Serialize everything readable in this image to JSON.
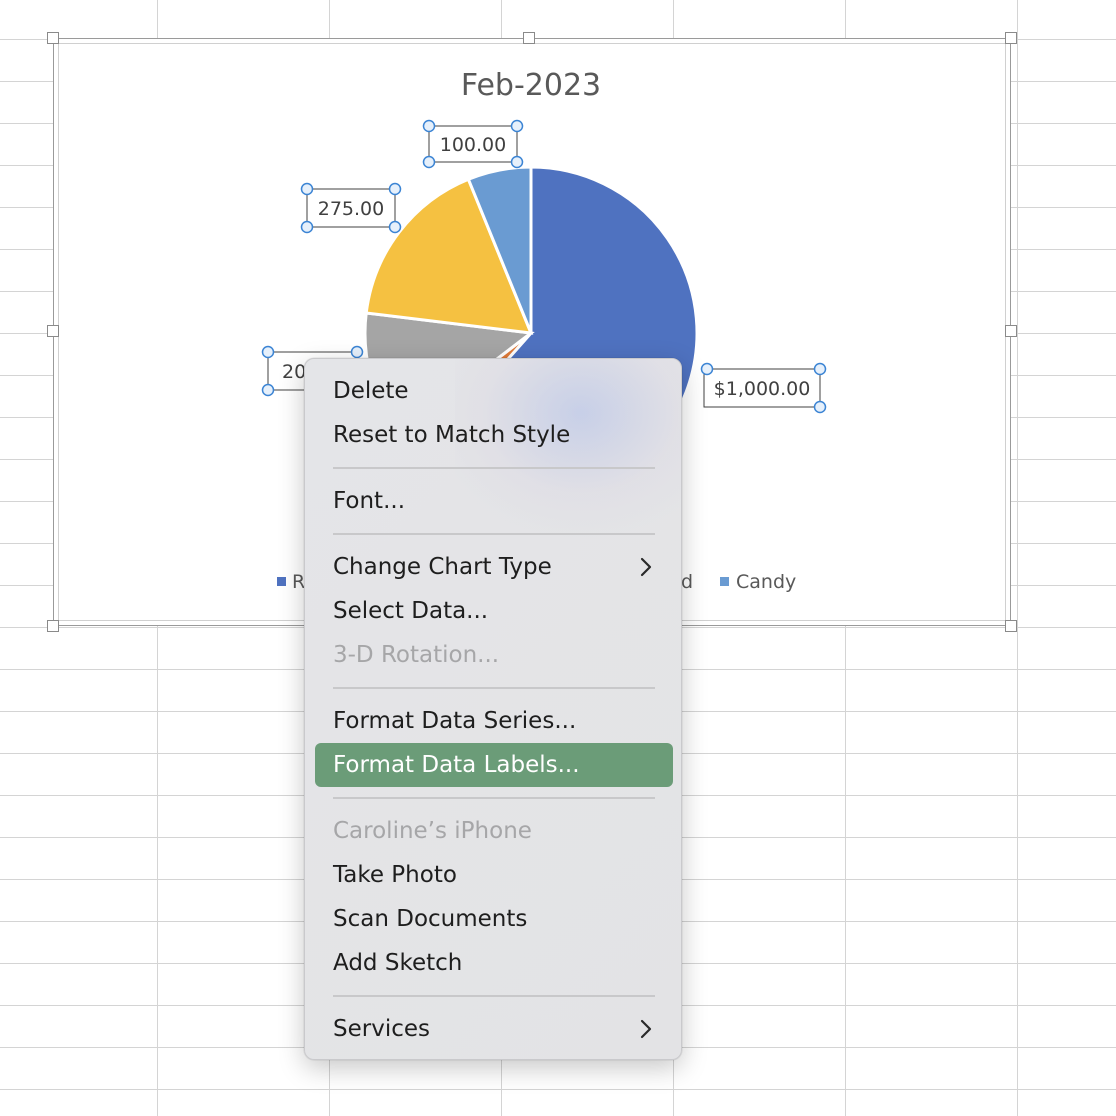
{
  "chart_data": {
    "type": "pie",
    "title": "Feb-2023",
    "slices": [
      {
        "name": "R",
        "value": 1000,
        "label": "$1,000.00",
        "color": "#4f72c0"
      },
      {
        "name": "",
        "value": 50,
        "label": "",
        "color": "#e07b39"
      },
      {
        "name": "",
        "value": 200,
        "label": "20",
        "color": "#a5a5a5"
      },
      {
        "name": "",
        "value": 275,
        "label": "275.00",
        "color": "#f5c141"
      },
      {
        "name": "Candy",
        "value": 100,
        "label": "100.00",
        "color": "#6a9bd2"
      }
    ],
    "legend": [
      {
        "name": "R",
        "color": "#4f72c0"
      },
      {
        "name": "d",
        "color": "#f5c141"
      },
      {
        "name": "Candy",
        "color": "#6a9bd2"
      }
    ],
    "legend_position": "bottom"
  },
  "context_menu": {
    "items": {
      "delete": "Delete",
      "reset": "Reset to Match Style",
      "font": "Font...",
      "change_chart_type": "Change Chart Type",
      "select_data": "Select Data...",
      "rotation": "3-D Rotation...",
      "format_series": "Format Data Series...",
      "format_labels": "Format Data Labels...",
      "device": "Caroline’s iPhone",
      "take_photo": "Take Photo",
      "scan_documents": "Scan Documents",
      "add_sketch": "Add Sketch",
      "services": "Services"
    },
    "highlight_color": "#6b9c78"
  }
}
